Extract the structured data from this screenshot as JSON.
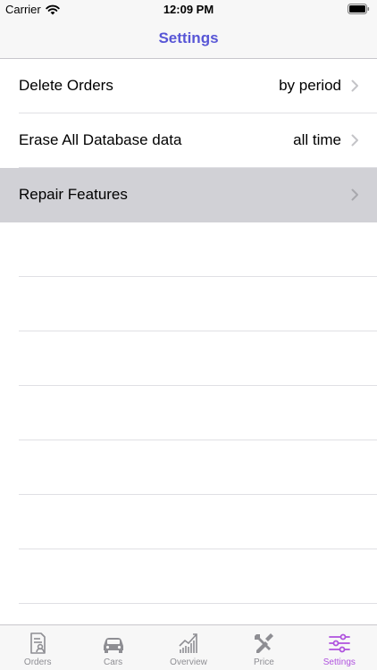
{
  "status_bar": {
    "carrier": "Carrier",
    "time": "12:09 PM"
  },
  "nav": {
    "title": "Settings"
  },
  "rows": [
    {
      "title": "Delete Orders",
      "detail": "by period",
      "selected": false
    },
    {
      "title": "Erase All Database data",
      "detail": "all time",
      "selected": false
    },
    {
      "title": "Repair Features",
      "detail": "",
      "selected": true
    }
  ],
  "tabs": [
    {
      "label": "Orders",
      "icon": "orders-icon",
      "active": false
    },
    {
      "label": "Cars",
      "icon": "car-icon",
      "active": false
    },
    {
      "label": "Overview",
      "icon": "chart-icon",
      "active": false
    },
    {
      "label": "Price",
      "icon": "tools-icon",
      "active": false
    },
    {
      "label": "Settings",
      "icon": "sliders-icon",
      "active": true
    }
  ],
  "colors": {
    "accent": "#5856d6",
    "tab_active": "#af52de",
    "tab_inactive": "#8e8e93",
    "selected_row": "#d1d1d6"
  }
}
